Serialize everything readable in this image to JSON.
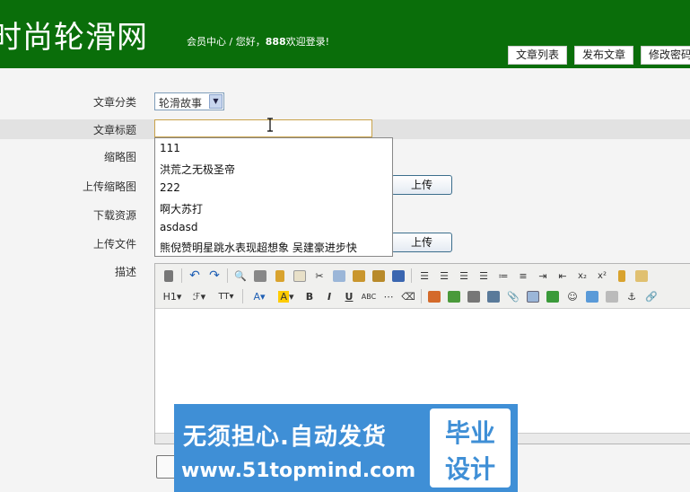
{
  "header": {
    "logo": "时尚轮滑网",
    "welcome_prefix": "会员中心 / 您好，",
    "username": "888",
    "welcome_suffix": "欢迎登录!",
    "nav": [
      {
        "label": "文章列表"
      },
      {
        "label": "发布文章"
      },
      {
        "label": "修改密码"
      }
    ]
  },
  "form": {
    "category_label": "文章分类",
    "category_value": "轮滑故事",
    "title_label": "文章标题",
    "title_value": "",
    "thumbnail_label": "缩略图",
    "upload_thumbnail_label": "上传缩略图",
    "download_label": "下载资源",
    "upload_file_label": "上传文件",
    "description_label": "描述",
    "upload_button": "上传"
  },
  "autocomplete": {
    "items": [
      "111",
      "洪荒之无极圣帝",
      "222",
      "啊大苏打",
      "asdasd",
      "熊倪赞明星跳水表现超想象 吴建豪进步快"
    ]
  },
  "editor": {
    "heading_button": "H1",
    "font_button": "ℱ",
    "size_button": "TT"
  },
  "watermark": {
    "text": "无须担心.自动发货",
    "url": "www.51topmind.com",
    "box_line1": "毕业",
    "box_line2": "设计"
  },
  "colors": {
    "header_bg": "#0a6e0a",
    "banner_bg": "#3f8fd6",
    "input_border": "#c8a24a"
  }
}
